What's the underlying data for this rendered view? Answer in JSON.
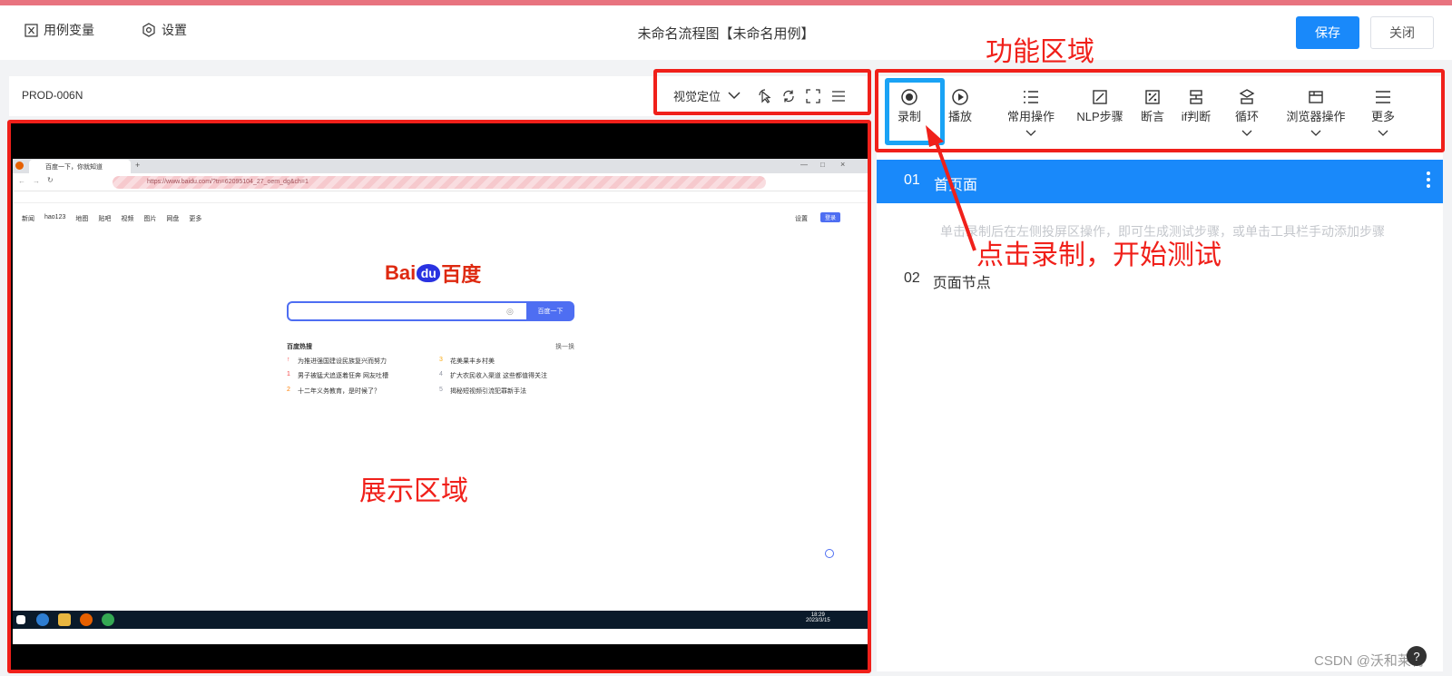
{
  "header": {
    "variables_label": "用例变量",
    "settings_label": "设置",
    "title": "未命名流程图【未命名用例】",
    "save_label": "保存",
    "close_label": "关闭"
  },
  "left_panel": {
    "case_id": "PROD-006N",
    "locate_mode": "视觉定位"
  },
  "embedded_browser": {
    "tab_title": "百度一下，你就知道",
    "url": "https://www.baidu.com/?tn=62095104_27_oem_dg&ch=1",
    "nav_links": [
      "新闻",
      "hao123",
      "地图",
      "贴吧",
      "视频",
      "图片",
      "网盘",
      "更多"
    ],
    "settings_link": "设置",
    "login_label": "登录",
    "logo_left": "Bai",
    "logo_du": "du",
    "logo_right": "百度",
    "search_button": "百度一下",
    "hot_title": "百度热搜",
    "hot_refresh": "换一换",
    "hot_items": [
      {
        "num": "",
        "text": "为推进强国建设民族复兴而努力"
      },
      {
        "num": "3",
        "text": "花美果丰乡村美"
      },
      {
        "num": "1",
        "text": "男子被猛犬追逐着狂奔 网友吐槽"
      },
      {
        "num": "4",
        "text": "扩大农民收入渠道 这些都值得关注"
      },
      {
        "num": "2",
        "text": "十二年义务教育，是时候了？"
      },
      {
        "num": "5",
        "text": "揭秘短视频引流犯罪新手法"
      }
    ],
    "clock_time": "18:29",
    "clock_date": "2023/3/15"
  },
  "toolbar": {
    "items": [
      {
        "label": "录制",
        "icon": "record-icon",
        "dropdown": false
      },
      {
        "label": "播放",
        "icon": "play-icon",
        "dropdown": false
      },
      {
        "label": "常用操作",
        "icon": "list-icon",
        "dropdown": true
      },
      {
        "label": "NLP步骤",
        "icon": "nlp-icon",
        "dropdown": false
      },
      {
        "label": "断言",
        "icon": "assert-icon",
        "dropdown": false
      },
      {
        "label": "if判断",
        "icon": "if-icon",
        "dropdown": false
      },
      {
        "label": "循环",
        "icon": "loop-icon",
        "dropdown": true
      },
      {
        "label": "浏览器操作",
        "icon": "browser-icon",
        "dropdown": true
      },
      {
        "label": "更多",
        "icon": "more-icon",
        "dropdown": true
      }
    ]
  },
  "steps": {
    "row1_num": "01",
    "row1_label": "首页面",
    "hint": "单击录制后在左侧投屏区操作，即可生成测试步骤，或单击工具栏手动添加步骤",
    "row2_num": "02",
    "row2_label": "页面节点"
  },
  "annotations": {
    "function_area": "功能区域",
    "display_area": "展示区域",
    "click_record": "点击录制，开始测试"
  },
  "watermark": "CSDN @沃和莱特",
  "colors": {
    "accent": "#1989fa",
    "annotation": "#f0201a"
  }
}
